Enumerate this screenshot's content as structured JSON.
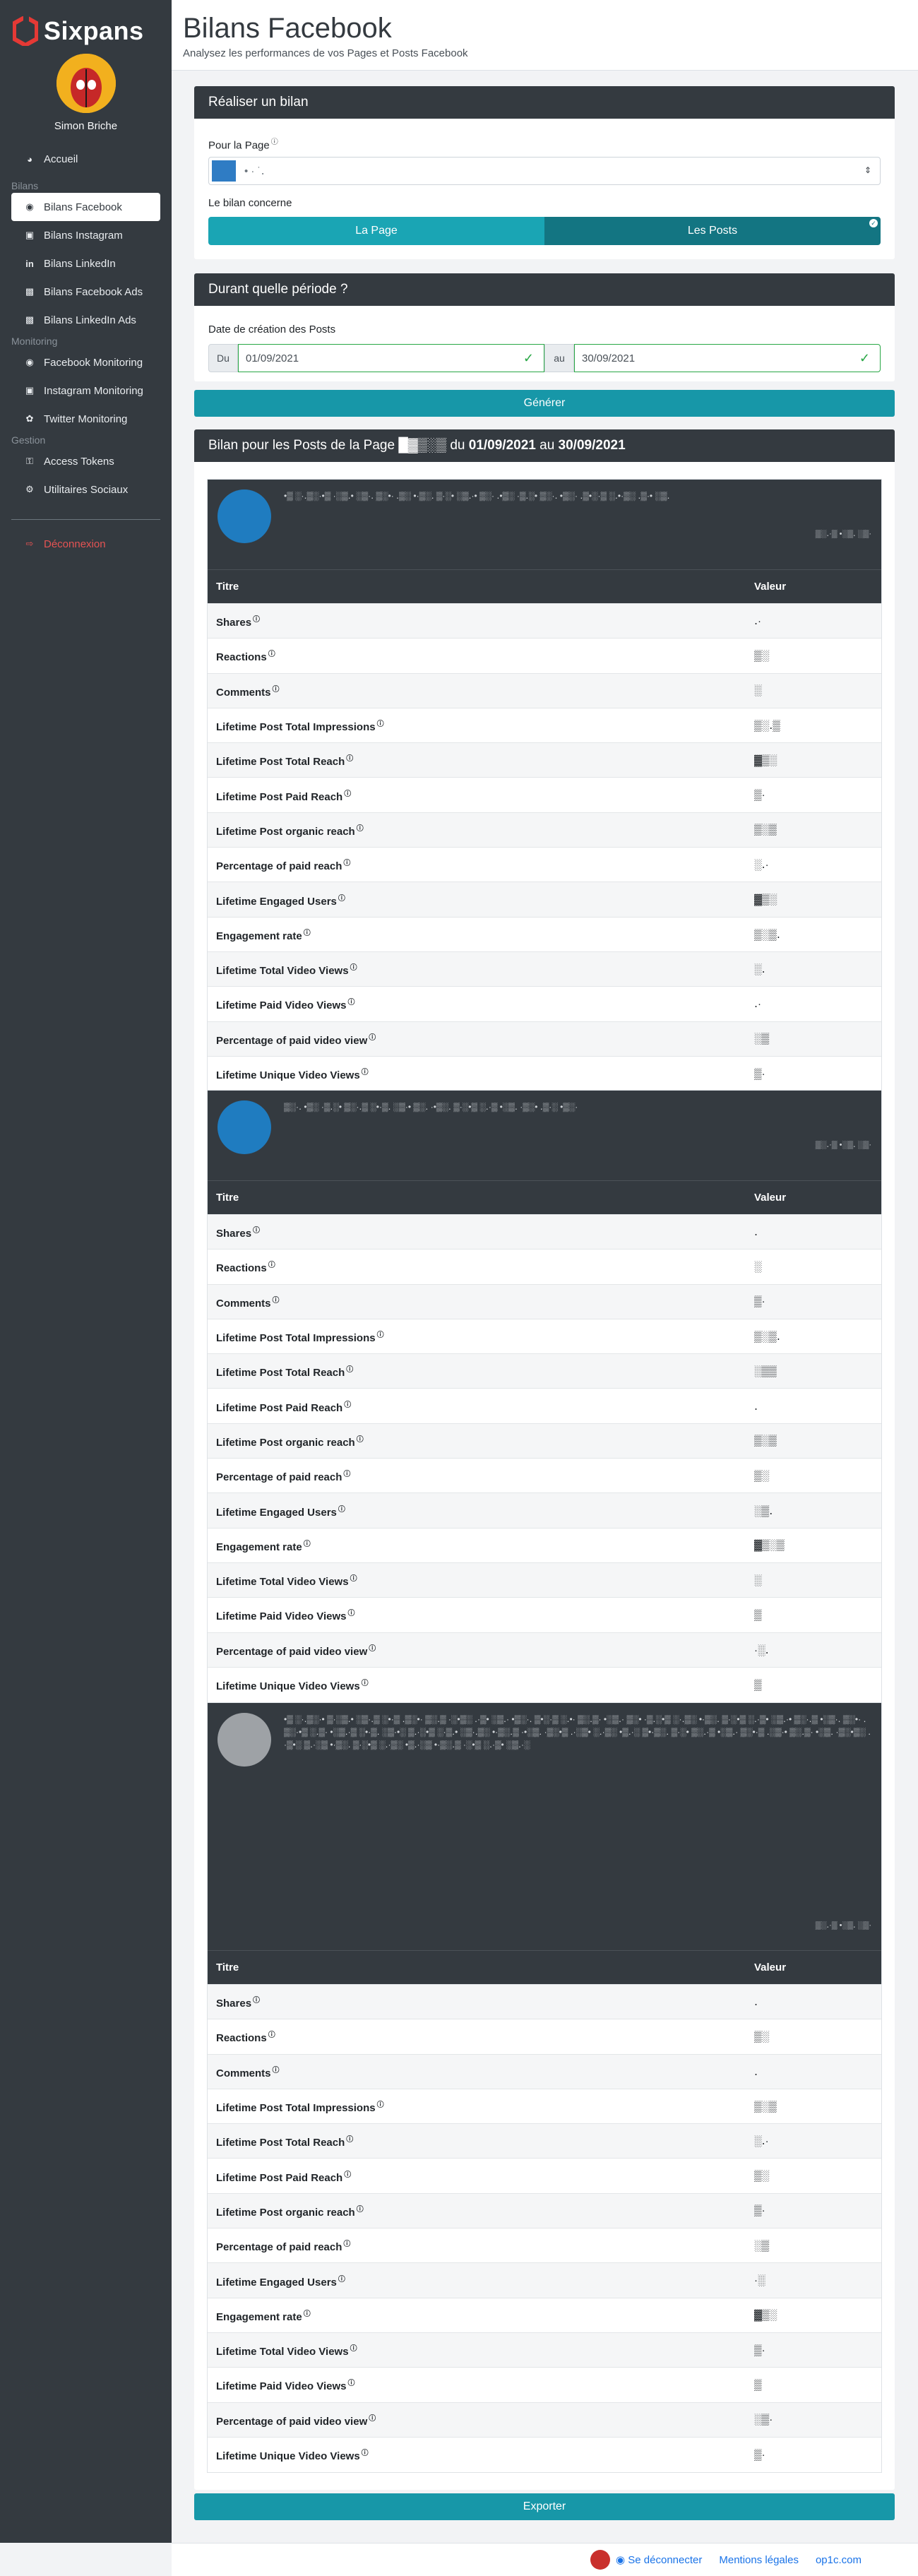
{
  "brand": {
    "name": "Sixpans"
  },
  "user": {
    "name": "Simon Briche"
  },
  "nav": {
    "home": "Accueil",
    "section_bilans": "Bilans",
    "bilans": [
      "Bilans Facebook",
      "Bilans Instagram",
      "Bilans LinkedIn",
      "Bilans Facebook Ads",
      "Bilans LinkedIn Ads"
    ],
    "section_monitoring": "Monitoring",
    "monitoring": [
      "Facebook Monitoring",
      "Instagram Monitoring",
      "Twitter Monitoring"
    ],
    "section_gestion": "Gestion",
    "gestion": [
      "Access Tokens",
      "Utilitaires Sociaux"
    ],
    "logout": "Déconnexion"
  },
  "header": {
    "title": "Bilans Facebook",
    "subtitle": "Analysez les performances de vos Pages et Posts Facebook"
  },
  "bilan_form": {
    "title": "Réaliser un bilan",
    "page_label": "Pour la Page",
    "page_value": "• · ˙․",
    "concerne_label": "Le bilan concerne",
    "opt_page": "La Page",
    "opt_posts": "Les Posts"
  },
  "period": {
    "title": "Durant quelle période ?",
    "date_label": "Date de création des Posts",
    "du": "Du",
    "from": "01/09/2021",
    "au": "au",
    "to": "30/09/2021"
  },
  "generate_button": "Générer",
  "results": {
    "title_prefix": "Bilan pour les Posts de la Page",
    "page_name": "█▓▒░▒",
    "du": "du",
    "from": "01/09/2021",
    "au": "au",
    "to": "30/09/2021",
    "col_title": "Titre",
    "col_value": "Valeur",
    "metrics": [
      "Shares",
      "Reactions",
      "Comments",
      "Lifetime Post Total Impressions",
      "Lifetime Post Total Reach",
      "Lifetime Post Paid Reach",
      "Lifetime Post organic reach",
      "Percentage of paid reach",
      "Lifetime Engaged Users",
      "Engagement rate",
      "Lifetime Total Video Views",
      "Lifetime Paid Video Views",
      "Percentage of paid video view",
      "Lifetime Unique Video Views"
    ],
    "posts": [
      {
        "text": "•▒ ░·․▒░·•▒ ·░▒․• ░▒·․ ▒░•· ․▒░ •·▒░․ ▒·░• ░▒․·• ▒░· ․•▒░ ·▒․░• ▒░·․ •▒░· ․▒•░·▒ ░․•·▒░ ․▒·• ░▒․",
        "date": "▒░․·▒ •░▒․ ░▒·",
        "values": [
          "․·",
          "▒░",
          "░",
          "▒░․▒",
          "▓▒░",
          "▒·",
          "▒░▒",
          "░․·",
          "▓▒░",
          "▒░▒․",
          "░․",
          "․·",
          "░▒",
          "▒·"
        ]
      },
      {
        "text": "▒░·․ •▒░ ·▒․░• ▒░·․▒ ░•·▒․ ░▒·• ▒░․ ·•▒░․ ▒·░•▒ ░․·▒ •░▒․ ·▒░• ․▒·░ •▒░·",
        "date": "▒░․·▒ •░▒․ ░▒·",
        "values": [
          "․",
          "░",
          "▒·",
          "▒░▒․",
          "░▒▒",
          "․",
          "▒░▒",
          "▒░",
          "░▒․",
          "▓▒░▒",
          "░",
          "▒",
          "·░․",
          "▒"
        ]
      },
      {
        "text": "•▒ ░·․▒░·• ▒·░▒․• ░▒·․▒ ░•·▒ ․▒░•· ▒░․▒ ·░•▒░ ․·▒• ░▒․· •▒░·․ ▒•░·▒ ░․•· ▒░․▒· •░▒․· ▒░• ·▒․░•▒ ░·․▒░ •·▒░․ ▒·░•▒ ░․·▒• ░▒․·• ▒░·․▒ •░▒·․ ▒░•· ․▒░·•▒ ░․▒· •░▒․·▒ ░•·▒․ ░▒·•░ ▒․·░•▒ ░·▒․• ░▒·․▒░ •·▒░․▒ ·•░▒․ ·▒░•▒ ․·░▒• ░․·▒░ •▒․·░ ▒•·▒░․ ▒·░• ▒░․·▒ •░▒․· ▒░•·▒ ․░▒·• ▒░․▒· •░▒․ ·▒░•▒░ ․·▒•░ ▒․·░▒ •·▒░․ ▒·░•▒ ░․·▒░ •▒․·░▒ •·▒░․▒ ·░•▒ ░․·▒• ░▒․·░",
        "date": "▒░․·▒ •░▒․ ░▒·",
        "values": [
          "․",
          "▒░",
          "․",
          "▒░▒",
          "░․·",
          "▒░",
          "▒·",
          "░▒",
          "·░",
          "▓▒░",
          "▒·",
          "▒",
          "░▒·",
          "▒·"
        ]
      }
    ]
  },
  "export_button": "Exporter",
  "footer": {
    "logout": "Se déconnecter",
    "legal": "Mentions légales",
    "site": "op1c.com"
  },
  "colors": {
    "sidebar": "#343a40",
    "accent": "#1797a8",
    "logout": "#e55353"
  }
}
